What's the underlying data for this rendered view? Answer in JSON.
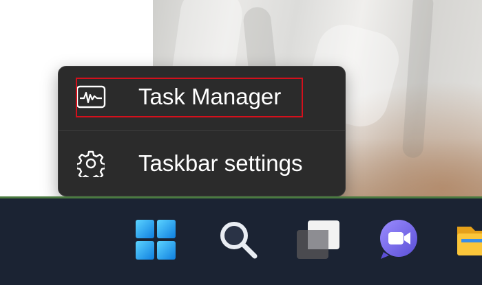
{
  "context_menu": {
    "items": [
      {
        "label": "Task Manager",
        "icon": "task-manager-icon",
        "highlighted": true
      },
      {
        "label": "Taskbar settings",
        "icon": "gear-icon",
        "highlighted": false
      }
    ],
    "highlight_color": "#d4101c",
    "background": "#2b2b2b"
  },
  "taskbar": {
    "background": "#1b2333",
    "buttons": [
      {
        "name": "start-button",
        "icon": "windows-logo-icon"
      },
      {
        "name": "search-button",
        "icon": "search-icon"
      },
      {
        "name": "task-view-button",
        "icon": "task-view-icon"
      },
      {
        "name": "teams-chat-button",
        "icon": "teams-video-icon"
      },
      {
        "name": "file-explorer-button",
        "icon": "folder-icon"
      }
    ]
  }
}
